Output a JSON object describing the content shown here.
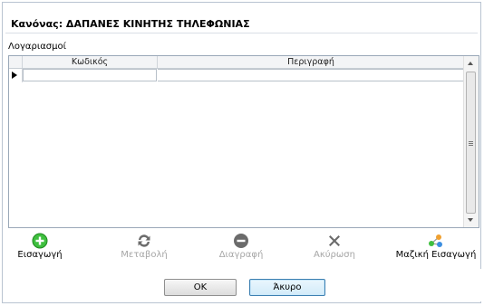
{
  "header": {
    "title": "Κανόνας: ΔΑΠΑΝΕΣ ΚΙΝΗΤΗΣ ΤΗΛΕΦΩΝΙΑΣ"
  },
  "accounts": {
    "label": "Λογαριασμοί",
    "columns": [
      "Κωδικός",
      "Περιγραφή"
    ],
    "rows": [
      {
        "code": "",
        "description": ""
      }
    ]
  },
  "toolbar": {
    "insert": "Εισαγωγή",
    "edit": "Μεταβολή",
    "delete": "Διαγραφή",
    "cancel": "Ακύρωση",
    "bulk_insert": "Μαζική Εισαγωγή"
  },
  "buttons": {
    "ok": "OK",
    "cancel": "Άκυρο"
  },
  "colors": {
    "add_green": "#3fbf3f",
    "disabled_icon": "#6b6b6b",
    "border": "#b9c4d1"
  }
}
